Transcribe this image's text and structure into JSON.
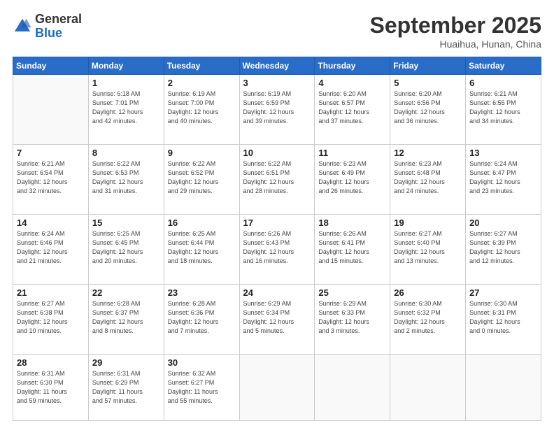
{
  "header": {
    "logo_general": "General",
    "logo_blue": "Blue",
    "month": "September 2025",
    "location": "Huaihua, Hunan, China"
  },
  "weekdays": [
    "Sunday",
    "Monday",
    "Tuesday",
    "Wednesday",
    "Thursday",
    "Friday",
    "Saturday"
  ],
  "rows": [
    [
      {
        "day": "",
        "data": ""
      },
      {
        "day": "1",
        "data": "Sunrise: 6:18 AM\nSunset: 7:01 PM\nDaylight: 12 hours\nand 42 minutes."
      },
      {
        "day": "2",
        "data": "Sunrise: 6:19 AM\nSunset: 7:00 PM\nDaylight: 12 hours\nand 40 minutes."
      },
      {
        "day": "3",
        "data": "Sunrise: 6:19 AM\nSunset: 6:59 PM\nDaylight: 12 hours\nand 39 minutes."
      },
      {
        "day": "4",
        "data": "Sunrise: 6:20 AM\nSunset: 6:57 PM\nDaylight: 12 hours\nand 37 minutes."
      },
      {
        "day": "5",
        "data": "Sunrise: 6:20 AM\nSunset: 6:56 PM\nDaylight: 12 hours\nand 36 minutes."
      },
      {
        "day": "6",
        "data": "Sunrise: 6:21 AM\nSunset: 6:55 PM\nDaylight: 12 hours\nand 34 minutes."
      }
    ],
    [
      {
        "day": "7",
        "data": "Sunrise: 6:21 AM\nSunset: 6:54 PM\nDaylight: 12 hours\nand 32 minutes."
      },
      {
        "day": "8",
        "data": "Sunrise: 6:22 AM\nSunset: 6:53 PM\nDaylight: 12 hours\nand 31 minutes."
      },
      {
        "day": "9",
        "data": "Sunrise: 6:22 AM\nSunset: 6:52 PM\nDaylight: 12 hours\nand 29 minutes."
      },
      {
        "day": "10",
        "data": "Sunrise: 6:22 AM\nSunset: 6:51 PM\nDaylight: 12 hours\nand 28 minutes."
      },
      {
        "day": "11",
        "data": "Sunrise: 6:23 AM\nSunset: 6:49 PM\nDaylight: 12 hours\nand 26 minutes."
      },
      {
        "day": "12",
        "data": "Sunrise: 6:23 AM\nSunset: 6:48 PM\nDaylight: 12 hours\nand 24 minutes."
      },
      {
        "day": "13",
        "data": "Sunrise: 6:24 AM\nSunset: 6:47 PM\nDaylight: 12 hours\nand 23 minutes."
      }
    ],
    [
      {
        "day": "14",
        "data": "Sunrise: 6:24 AM\nSunset: 6:46 PM\nDaylight: 12 hours\nand 21 minutes."
      },
      {
        "day": "15",
        "data": "Sunrise: 6:25 AM\nSunset: 6:45 PM\nDaylight: 12 hours\nand 20 minutes."
      },
      {
        "day": "16",
        "data": "Sunrise: 6:25 AM\nSunset: 6:44 PM\nDaylight: 12 hours\nand 18 minutes."
      },
      {
        "day": "17",
        "data": "Sunrise: 6:26 AM\nSunset: 6:43 PM\nDaylight: 12 hours\nand 16 minutes."
      },
      {
        "day": "18",
        "data": "Sunrise: 6:26 AM\nSunset: 6:41 PM\nDaylight: 12 hours\nand 15 minutes."
      },
      {
        "day": "19",
        "data": "Sunrise: 6:27 AM\nSunset: 6:40 PM\nDaylight: 12 hours\nand 13 minutes."
      },
      {
        "day": "20",
        "data": "Sunrise: 6:27 AM\nSunset: 6:39 PM\nDaylight: 12 hours\nand 12 minutes."
      }
    ],
    [
      {
        "day": "21",
        "data": "Sunrise: 6:27 AM\nSunset: 6:38 PM\nDaylight: 12 hours\nand 10 minutes."
      },
      {
        "day": "22",
        "data": "Sunrise: 6:28 AM\nSunset: 6:37 PM\nDaylight: 12 hours\nand 8 minutes."
      },
      {
        "day": "23",
        "data": "Sunrise: 6:28 AM\nSunset: 6:36 PM\nDaylight: 12 hours\nand 7 minutes."
      },
      {
        "day": "24",
        "data": "Sunrise: 6:29 AM\nSunset: 6:34 PM\nDaylight: 12 hours\nand 5 minutes."
      },
      {
        "day": "25",
        "data": "Sunrise: 6:29 AM\nSunset: 6:33 PM\nDaylight: 12 hours\nand 3 minutes."
      },
      {
        "day": "26",
        "data": "Sunrise: 6:30 AM\nSunset: 6:32 PM\nDaylight: 12 hours\nand 2 minutes."
      },
      {
        "day": "27",
        "data": "Sunrise: 6:30 AM\nSunset: 6:31 PM\nDaylight: 12 hours\nand 0 minutes."
      }
    ],
    [
      {
        "day": "28",
        "data": "Sunrise: 6:31 AM\nSunset: 6:30 PM\nDaylight: 11 hours\nand 59 minutes."
      },
      {
        "day": "29",
        "data": "Sunrise: 6:31 AM\nSunset: 6:29 PM\nDaylight: 11 hours\nand 57 minutes."
      },
      {
        "day": "30",
        "data": "Sunrise: 6:32 AM\nSunset: 6:27 PM\nDaylight: 11 hours\nand 55 minutes."
      },
      {
        "day": "",
        "data": ""
      },
      {
        "day": "",
        "data": ""
      },
      {
        "day": "",
        "data": ""
      },
      {
        "day": "",
        "data": ""
      }
    ]
  ]
}
